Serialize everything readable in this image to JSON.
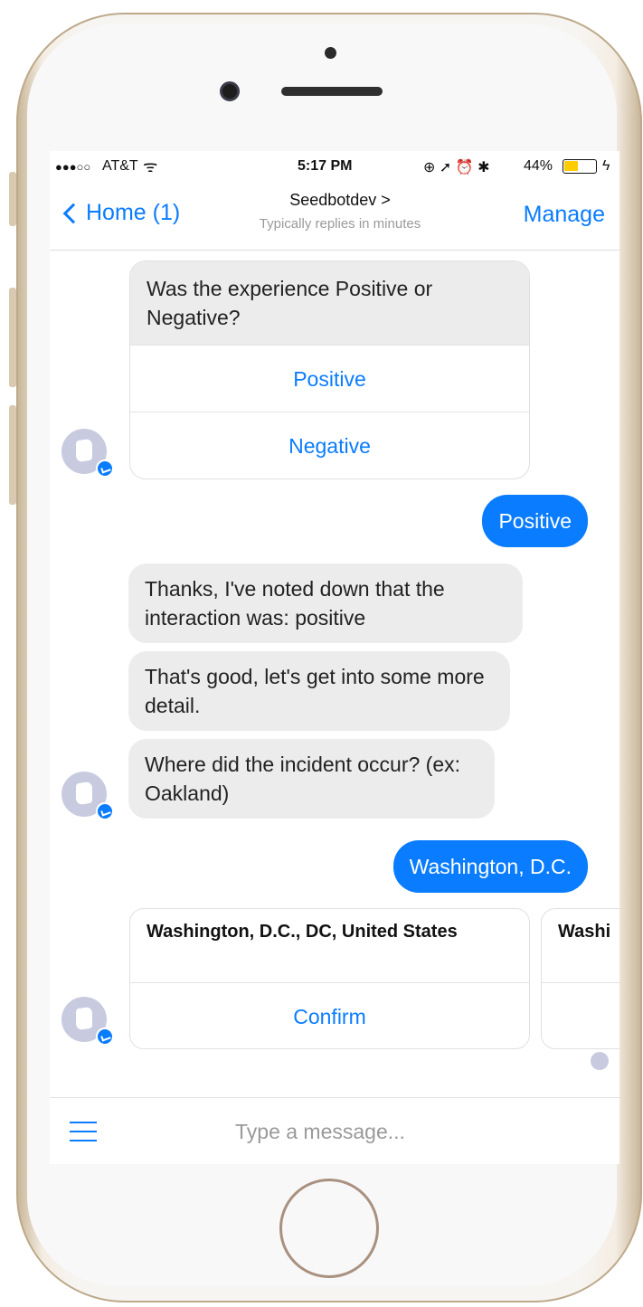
{
  "status_bar": {
    "signal": "●●●○○",
    "carrier": "AT&T",
    "time": "5:17 PM",
    "icons": "⊕ ➚ ⏰ ✱",
    "battery": "44%",
    "battery_level": 0.44,
    "battery_color": "#ffcc00"
  },
  "nav": {
    "back_label": "Home (1)",
    "title": "Seedbotdev >",
    "subtitle": "Typically replies in minutes",
    "manage_label": "Manage"
  },
  "messages": {
    "question": "Was the experience Positive or Negative?",
    "option_positive": "Positive",
    "option_negative": "Negative",
    "reply_positive": "Positive",
    "bot_1": "Thanks, I've noted down that the interaction was: positive",
    "bot_2": "That's good, let's get into some more detail.",
    "bot_3": "Where did the incident occur? (ex: Oakland)",
    "reply_location": "Washington, D.C."
  },
  "carousel": [
    {
      "title": "Washington, D.C., DC, United States",
      "button": "Confirm"
    },
    {
      "title": "Washi",
      "button": ""
    }
  ],
  "composer": {
    "placeholder": "Type a message..."
  },
  "colors": {
    "accent": "#0a7cff",
    "incoming_bubble": "#ececec"
  }
}
